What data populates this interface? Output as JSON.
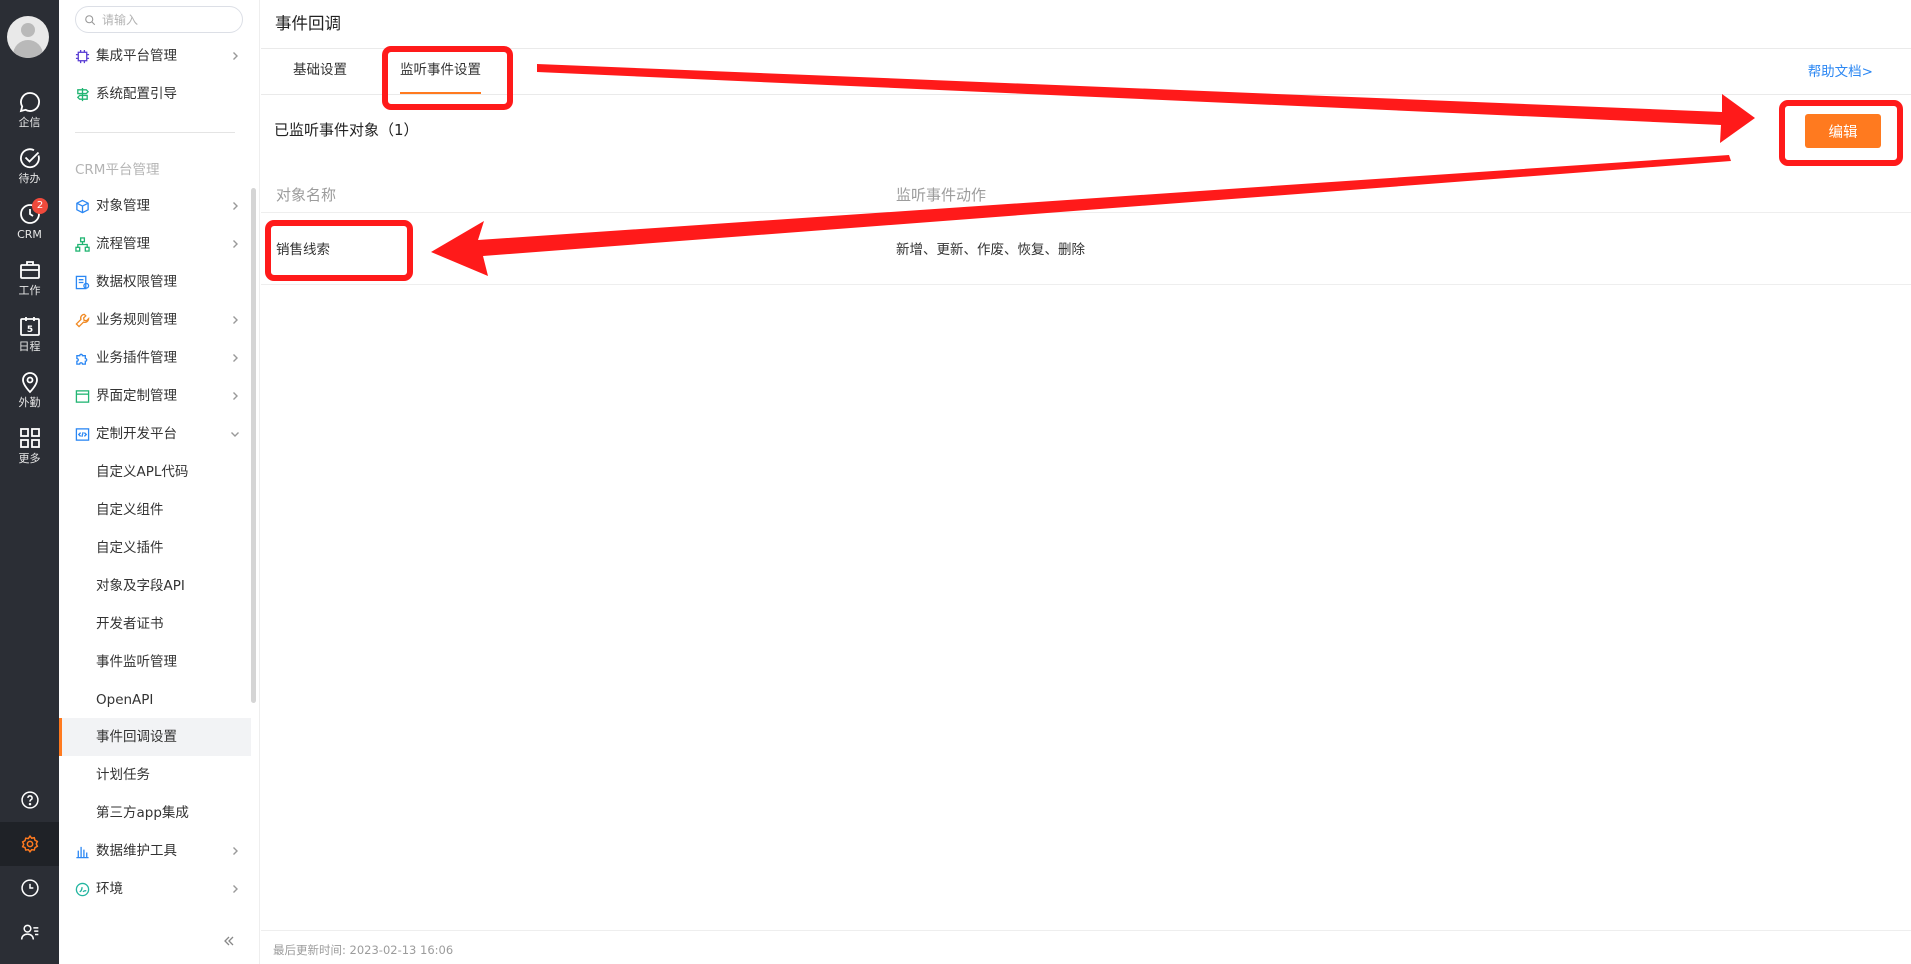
{
  "rail": {
    "items": [
      {
        "icon": "chat-icon",
        "label": "企信"
      },
      {
        "icon": "check-circle-icon",
        "label": "待办"
      },
      {
        "icon": "clock-icon",
        "label": "CRM",
        "badge": "2"
      },
      {
        "icon": "briefcase-icon",
        "label": "工作"
      },
      {
        "icon": "calendar-icon",
        "label": "日程"
      },
      {
        "icon": "location-pin-icon",
        "label": "外勤"
      },
      {
        "icon": "grid-icon",
        "label": "更多"
      }
    ],
    "bottom": [
      "help-icon",
      "settings-icon",
      "history-icon",
      "user-list-icon"
    ],
    "accent": "#ff7a1f"
  },
  "sidebar": {
    "search_placeholder": "请输入",
    "top_items": [
      {
        "label": "集成平台管理",
        "icon": "chip-icon",
        "has_arrow": true
      },
      {
        "label": "系统配置引导",
        "icon": "signpost-icon",
        "has_arrow": false
      }
    ],
    "section_title": "CRM平台管理",
    "items": [
      {
        "label": "对象管理",
        "icon": "cube-icon",
        "has_arrow": true
      },
      {
        "label": "流程管理",
        "icon": "flow-icon",
        "has_arrow": true
      },
      {
        "label": "数据权限管理",
        "icon": "data-permission-icon",
        "has_arrow": false
      },
      {
        "label": "业务规则管理",
        "icon": "wrench-icon",
        "has_arrow": true
      },
      {
        "label": "业务插件管理",
        "icon": "puzzle-icon",
        "has_arrow": true
      },
      {
        "label": "界面定制管理",
        "icon": "layout-icon",
        "has_arrow": true
      },
      {
        "label": "定制开发平台",
        "icon": "code-icon",
        "expanded": true
      }
    ],
    "sub_items": [
      {
        "label": "自定义APL代码"
      },
      {
        "label": "自定义组件"
      },
      {
        "label": "自定义插件"
      },
      {
        "label": "对象及字段API"
      },
      {
        "label": "开发者证书"
      },
      {
        "label": "事件监听管理"
      },
      {
        "label": "OpenAPI"
      },
      {
        "label": "事件回调设置",
        "active": true
      },
      {
        "label": "计划任务"
      },
      {
        "label": "第三方app集成"
      }
    ],
    "bottom_items": [
      {
        "label": "数据维护工具",
        "icon": "bar-chart-icon",
        "has_arrow": true
      },
      {
        "label": "环境",
        "icon": "environment-icon",
        "has_arrow": true
      }
    ]
  },
  "main": {
    "title": "事件回调",
    "tabs": [
      {
        "label": "基础设置",
        "active": false
      },
      {
        "label": "监听事件设置",
        "active": true
      }
    ],
    "help_link": "帮助文档>",
    "section_title": "已监听事件对象（1）",
    "edit_button": "编辑",
    "table": {
      "headers": [
        "对象名称",
        "监听事件动作"
      ],
      "rows": [
        [
          "销售线索",
          "新增、更新、作废、恢复、删除"
        ]
      ]
    },
    "footer": "最后更新时间:  2023-02-13 16:06"
  }
}
